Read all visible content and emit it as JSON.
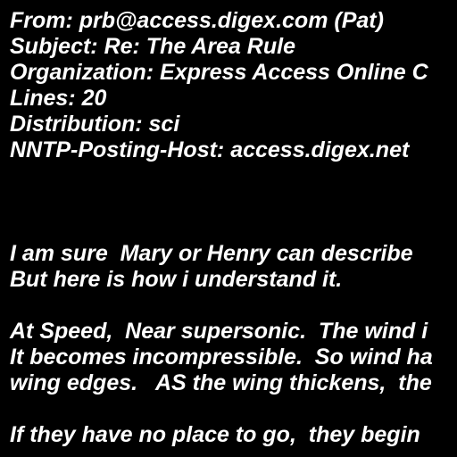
{
  "header": {
    "from": "From: prb@access.digex.com (Pat)",
    "subject": "Subject: Re: The Area Rule",
    "organization": "Organization: Express Access Online C",
    "lines": "Lines: 20",
    "distribution": "Distribution: sci",
    "nntp_posting_host": "NNTP-Posting-Host: access.digex.net"
  },
  "body": [
    "I am sure  Mary or Henry can describe",
    "But here is how i understand it.",
    "",
    "At Speed,  Near supersonic.  The wind i",
    "It becomes incompressible.  So wind ha",
    "wing edges.   AS the wing thickens,  the",
    "",
    "If they have no place to go,  they begin"
  ],
  "colors": {
    "background": "#000000",
    "text": "#ffffff"
  }
}
